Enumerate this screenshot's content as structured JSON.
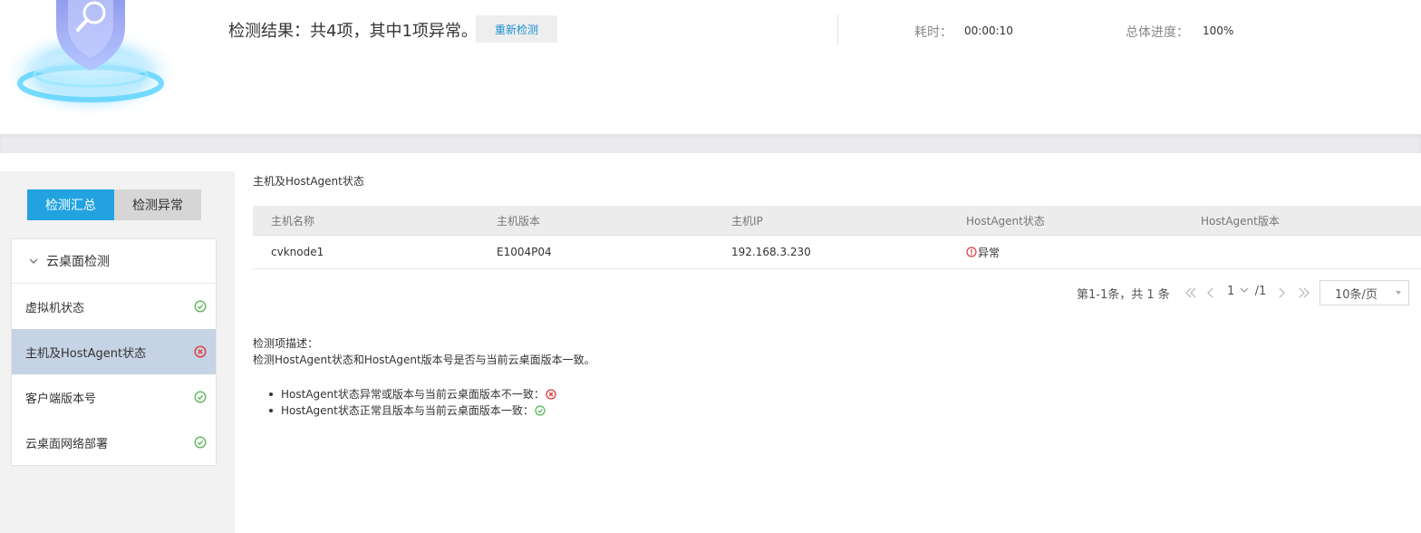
{
  "header": {
    "result_text": "检测结果：共4项，其中1项异常。",
    "recheck_label": "重新检测",
    "elapsed_label": "耗时：",
    "elapsed_value": "00:00:10",
    "progress_label": "总体进度：",
    "progress_value": "100%"
  },
  "sidebar": {
    "tabs": [
      {
        "label": "检测汇总",
        "active": true
      },
      {
        "label": "检测异常",
        "active": false
      }
    ],
    "group_label": "云桌面检测",
    "items": [
      {
        "label": "虚拟机状态",
        "status": "ok"
      },
      {
        "label": "主机及HostAgent状态",
        "status": "error",
        "selected": true
      },
      {
        "label": "客户端版本号",
        "status": "ok"
      },
      {
        "label": "云桌面网络部署",
        "status": "ok"
      }
    ]
  },
  "main": {
    "section_title": "主机及HostAgent状态",
    "table": {
      "columns": [
        "主机名称",
        "主机版本",
        "主机IP",
        "HostAgent状态",
        "HostAgent版本"
      ],
      "rows": [
        {
          "host_name": "cvknode1",
          "host_version": "E1004P04",
          "host_ip": "192.168.3.230",
          "agent_status": "异常",
          "agent_version": ""
        }
      ]
    },
    "pagination": {
      "summary": "第1-1条，共 1 条",
      "current": "1",
      "total": "/1",
      "page_size": "10条/页"
    },
    "description": {
      "title": "检测项描述：",
      "text": "检测HostAgent状态和HostAgent版本号是否与当前云桌面版本一致。",
      "bullets": [
        {
          "text": "HostAgent状态异常或版本与当前云桌面版本不一致：",
          "status": "error"
        },
        {
          "text": "HostAgent状态正常且版本与当前云桌面版本一致：",
          "status": "ok"
        }
      ]
    }
  },
  "colors": {
    "accent": "#22a3e0",
    "ok": "#5cb85c",
    "error": "#e0393e",
    "link": "#1a8fd1",
    "selected_row": "#c6d3e4"
  }
}
